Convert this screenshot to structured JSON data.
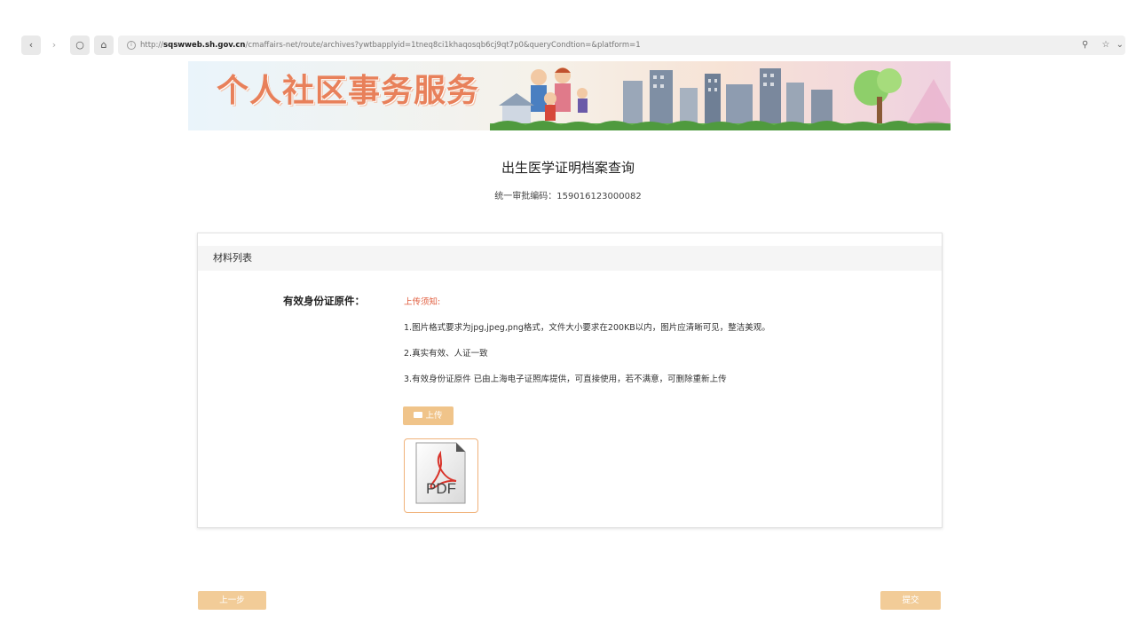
{
  "browser": {
    "url_prefix": "http://",
    "url_host": "sqswweb.sh.gov.cn",
    "url_path": "/cmaffairs-net/route/archives?ywtbapplyid=1tneq8ci1khaqosqb6cj9qt7p0&queryCondtion=&platform=1"
  },
  "banner": {
    "title": "个人社区事务服务"
  },
  "page": {
    "title": "出生医学证明档案查询",
    "approval_code": "统一审批编码：159016123000082"
  },
  "materials": {
    "header": "材料列表",
    "field_label": "有效身份证原件：",
    "notice_title": "上传须知:",
    "rules": [
      "1.图片格式要求为jpg,jpeg,png格式，文件大小要求在200KB以内，图片应清晰可见，整洁美观。",
      "2.真实有效、人证一致",
      "3.有效身份证原件 已由上海电子证照库提供，可直接使用，若不满意，可删除重新上传"
    ],
    "upload_label": "上传",
    "thumbnail_text": "PDF"
  },
  "actions": {
    "prev_label": "上一步",
    "submit_label": "提交"
  },
  "colors": {
    "accent": "#f0c48a",
    "notice": "#e05a3a",
    "pdf_red": "#d9342b"
  }
}
